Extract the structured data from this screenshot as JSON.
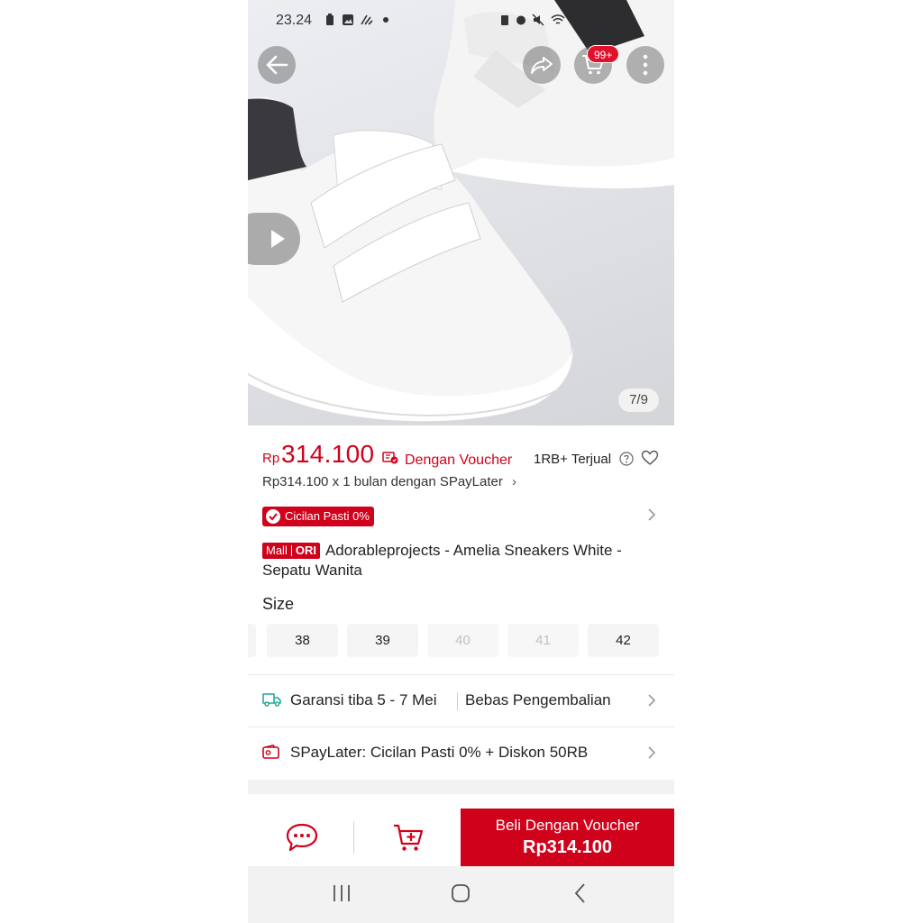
{
  "status_bar": {
    "time": "23.24"
  },
  "hero": {
    "image_counter": "7/9",
    "cart_badge": "99+"
  },
  "price": {
    "currency": "Rp",
    "amount": "314.100",
    "voucher_label": "Dengan Voucher",
    "sold": "1RB+ Terjual",
    "installment": "Rp314.100 x 1 bulan dengan SPayLater"
  },
  "promo": {
    "cicilan_badge": "Cicilan Pasti 0%"
  },
  "product": {
    "mall_badge": "Mall",
    "ori_badge": "ORI",
    "title": "Adorableprojects - Amelia Sneakers White - Sepatu Wanita"
  },
  "size": {
    "label": "Size",
    "options": [
      {
        "label": "38",
        "available": true
      },
      {
        "label": "39",
        "available": true
      },
      {
        "label": "40",
        "available": false
      },
      {
        "label": "41",
        "available": false
      },
      {
        "label": "42",
        "available": true
      }
    ]
  },
  "shipping": {
    "guarantee": "Garansi tiba 5 - 7 Mei",
    "returns": "Bebas Pengembalian"
  },
  "spaylater": {
    "text": "SPayLater: Cicilan Pasti 0% + Diskon 50RB"
  },
  "action_bar": {
    "buy_label": "Beli Dengan Voucher",
    "buy_price": "Rp314.100"
  },
  "colors": {
    "accent": "#d0011b",
    "shipping_icon": "#26aa99"
  },
  "icons": [
    "back-arrow-icon",
    "share-icon",
    "cart-icon",
    "more-vertical-icon",
    "play-icon",
    "voucher-icon",
    "help-icon",
    "heart-icon",
    "check-badge-icon",
    "truck-icon",
    "wallet-icon",
    "chat-icon",
    "add-to-cart-icon"
  ]
}
